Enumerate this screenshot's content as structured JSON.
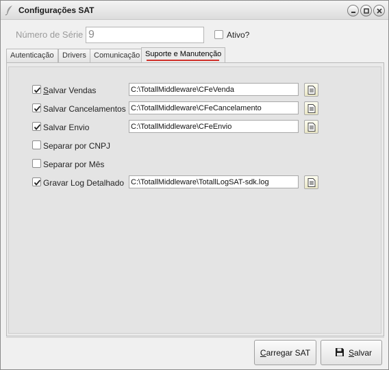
{
  "window": {
    "title": "Configurações SAT"
  },
  "serial": {
    "label": "Número de Série",
    "value": "9",
    "ativo_label": "Ativo?",
    "ativo_checked": false
  },
  "tabs": [
    {
      "label": "Autenticação",
      "active": false
    },
    {
      "label": "Drivers",
      "active": false
    },
    {
      "label": "Comunicação",
      "active": false
    },
    {
      "label": "Suporte e Manutenção",
      "active": true
    }
  ],
  "options": [
    {
      "label_first": "S",
      "label_rest": "alvar Vendas",
      "checked": true,
      "path": "C:\\TotallMiddleware\\CFeVenda"
    },
    {
      "label": "Salvar Cancelamentos",
      "checked": true,
      "path": "C:\\TotallMiddleware\\CFeCancelamento"
    },
    {
      "label": "Salvar Envio",
      "checked": true,
      "path": "C:\\TotallMiddleware\\CFeEnvio"
    },
    {
      "label": "Separar por CNPJ",
      "checked": false
    },
    {
      "label": "Separar por Mês",
      "checked": false
    },
    {
      "label": "Gravar Log Detalhado",
      "checked": true,
      "path": "C:\\TotallMiddleware\\TotallLogSAT-sdk.log"
    }
  ],
  "buttons": {
    "carregar_first": "C",
    "carregar_rest": "arregar SAT",
    "salvar_first": "S",
    "salvar_rest": "alvar"
  },
  "icons": {
    "app": "feather-icon",
    "minimize": "minimize-icon",
    "maximize": "maximize-icon",
    "close": "close-icon",
    "browse": "document-icon",
    "save": "floppy-disk-icon"
  }
}
